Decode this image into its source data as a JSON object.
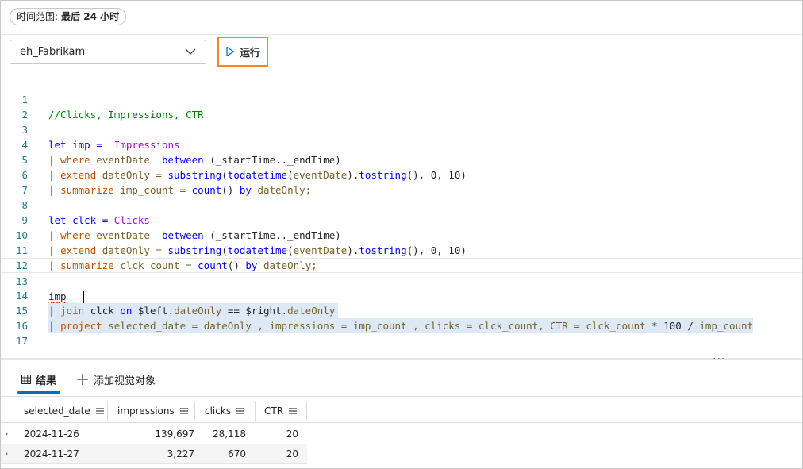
{
  "time_range": {
    "label": "时间范围:",
    "value": "最后 24 小时"
  },
  "database": {
    "selected": "eh_Fabrikam"
  },
  "run_button": {
    "label": "运行"
  },
  "editor": {
    "lines": [
      {
        "n": "1"
      },
      {
        "n": "2"
      },
      {
        "n": "3"
      },
      {
        "n": "4"
      },
      {
        "n": "5"
      },
      {
        "n": "6"
      },
      {
        "n": "7"
      },
      {
        "n": "8"
      },
      {
        "n": "9"
      },
      {
        "n": "10"
      },
      {
        "n": "11"
      },
      {
        "n": "12"
      },
      {
        "n": "13"
      },
      {
        "n": "14"
      },
      {
        "n": "15"
      },
      {
        "n": "16"
      },
      {
        "n": "17"
      }
    ],
    "code": {
      "l1": "//Clicks, Impressions, CTR",
      "l3a": "let imp = ",
      "l3b": " Impressions",
      "l4a": "| ",
      "l4b": "where",
      "l4c": " eventDate  ",
      "l4d": "between",
      "l4e": " (_startTime.._endTime)",
      "l5a": "| ",
      "l5b": "extend",
      "l5c": " dateOnly = ",
      "l5d": "substring",
      "l5e": "(",
      "l5f": "todatetime",
      "l5g": "(",
      "l5h": "eventDate",
      "l5i": ").",
      "l5j": "tostring",
      "l5k": "(), 0, 10)",
      "l6a": "| ",
      "l6b": "summarize",
      "l6c": " imp_count = ",
      "l6d": "count",
      "l6e": "() ",
      "l6f": "by",
      "l6g": " dateOnly;",
      "l8a": "let clck = ",
      "l8b": "Clicks",
      "l9a": "| ",
      "l9b": "where",
      "l9c": " eventDate  ",
      "l9d": "between",
      "l9e": " (_startTime.._endTime)",
      "l10a": "| ",
      "l10b": "extend",
      "l10c": " dateOnly = ",
      "l10d": "substring",
      "l10e": "(",
      "l10f": "todatetime",
      "l10g": "(",
      "l10h": "eventDate",
      "l10i": ").",
      "l10j": "tostring",
      "l10k": "(), 0, 10)",
      "l11a": "| ",
      "l11b": "summarize",
      "l11c": " clck_count = ",
      "l11d": "count",
      "l11e": "() ",
      "l11f": "by",
      "l11g": " dateOnly;",
      "l13": "imp",
      "l14a": "| ",
      "l14b": "join",
      "l14c": " clck ",
      "l14d": "on",
      "l14e": " $left.",
      "l14f": "dateOnly",
      "l14g": " == $right.",
      "l14h": "dateOnly",
      "l15a": "| ",
      "l15b": "project",
      "l15c": " selected_date = ",
      "l15d": "dateOnly",
      "l15e": " , impressions = ",
      "l15f": "imp_count",
      "l15g": " , clicks = ",
      "l15h": "clck_count",
      "l15i": ", CTR = ",
      "l15j": "clck_count",
      "l15k": " * 100 / ",
      "l15l": "imp_count"
    }
  },
  "results": {
    "tab_results": "结果",
    "tab_add_visual": "添加视觉对象",
    "columns": [
      "selected_date",
      "impressions",
      "clicks",
      "CTR"
    ],
    "rows": [
      {
        "selected_date": "2024-11-26",
        "impressions": "139,697",
        "clicks": "28,118",
        "CTR": "20"
      },
      {
        "selected_date": "2024-11-27",
        "impressions": "3,227",
        "clicks": "670",
        "CTR": "20"
      }
    ]
  },
  "icons": {
    "run": "play-icon",
    "select": "chevron-down-icon",
    "results": "grid-icon",
    "add": "plus-icon",
    "more": "more-icon",
    "column_menu": "menu-icon",
    "expand": "chevron-right-icon"
  },
  "colors": {
    "run_highlight": "#f08a24",
    "tab_accent": "#0f6cbd",
    "selection": "#dde9f7"
  }
}
